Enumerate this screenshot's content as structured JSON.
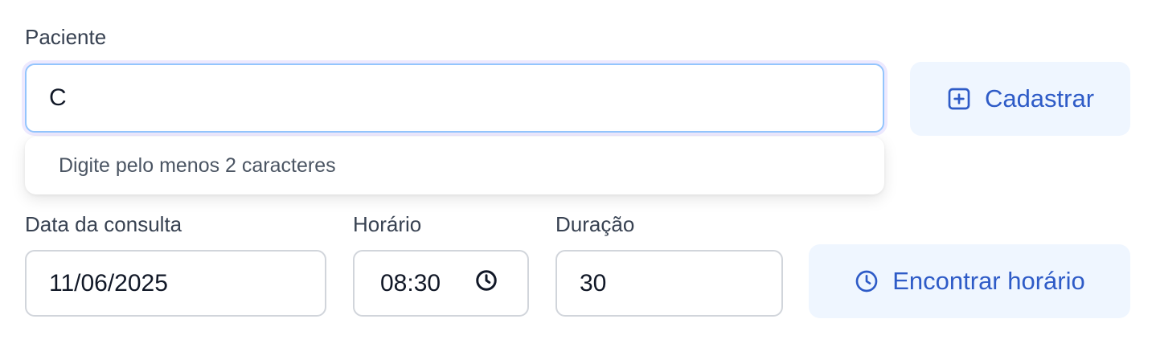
{
  "patient": {
    "label": "Paciente",
    "value": "C",
    "hint": "Digite pelo menos 2 caracteres",
    "register_button": "Cadastrar"
  },
  "appointment": {
    "date_label": "Data da consulta",
    "date_value": "11/06/2025",
    "time_label": "Horário",
    "time_value": "08:30",
    "duration_label": "Duração",
    "duration_value": "30",
    "find_button": "Encontrar horário"
  },
  "icons": {
    "register": "plus-square-icon",
    "find": "clock-icon",
    "time_picker": "clock-icon"
  },
  "colors": {
    "accent": "#2e5bc7",
    "button_bg": "#eff6ff",
    "focus_border": "#93c5fd"
  }
}
